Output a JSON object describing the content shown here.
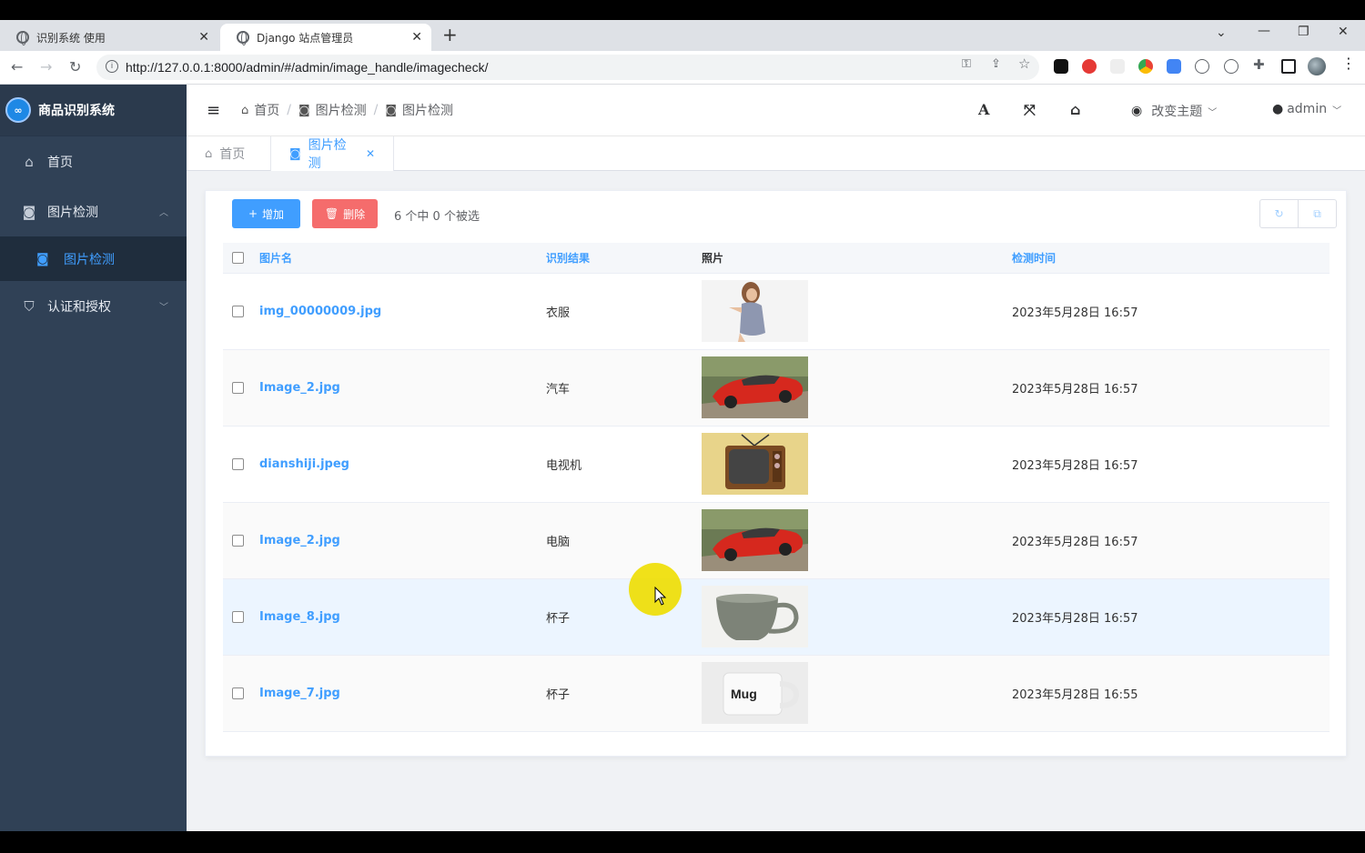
{
  "browser": {
    "tabs": [
      {
        "title": "识别系统 使用",
        "active": false
      },
      {
        "title": "Django 站点管理员",
        "active": true
      }
    ],
    "url": "http://127.0.0.1:8000/admin/#/admin/image_handle/imagecheck/"
  },
  "sidebar": {
    "brand": "商品识别系统",
    "logo_text": "∞",
    "items": [
      {
        "label": "首页",
        "icon": "home-icon"
      },
      {
        "label": "图片检测",
        "icon": "camera-icon",
        "expanded": true
      },
      {
        "label": "图片检测",
        "icon": "camera-icon",
        "sub": true,
        "active": true
      },
      {
        "label": "认证和授权",
        "icon": "shield-icon"
      }
    ]
  },
  "header": {
    "breadcrumb": [
      "首页",
      "图片检测",
      "图片检测"
    ],
    "theme_label": "改变主题",
    "user": "admin"
  },
  "page_tabs": [
    {
      "label": "首页",
      "active": false
    },
    {
      "label": "图片检测",
      "active": true
    }
  ],
  "toolbar": {
    "add_label": "增加",
    "delete_label": "删除",
    "selection_info": "6 个中 0 个被选"
  },
  "table": {
    "columns": [
      "图片名",
      "识别结果",
      "照片",
      "检测时间"
    ],
    "rows": [
      {
        "name": "img_00000009.jpg",
        "result": "衣服",
        "photo": "woman",
        "time": "2023年5月28日 16:57"
      },
      {
        "name": "Image_2.jpg",
        "result": "汽车",
        "photo": "car",
        "time": "2023年5月28日 16:57"
      },
      {
        "name": "dianshiji.jpeg",
        "result": "电视机",
        "photo": "tv",
        "time": "2023年5月28日 16:57"
      },
      {
        "name": "Image_2.jpg",
        "result": "电脑",
        "photo": "car",
        "time": "2023年5月28日 16:57"
      },
      {
        "name": "Image_8.jpg",
        "result": "杯子",
        "photo": "cup",
        "time": "2023年5月28日 16:57"
      },
      {
        "name": "Image_7.jpg",
        "result": "杯子",
        "photo": "mug",
        "time": "2023年5月28日 16:55"
      }
    ],
    "mug_label": "Mug"
  },
  "colors": {
    "primary": "#409eff",
    "danger": "#f56c6c",
    "sidebar": "#304156"
  }
}
